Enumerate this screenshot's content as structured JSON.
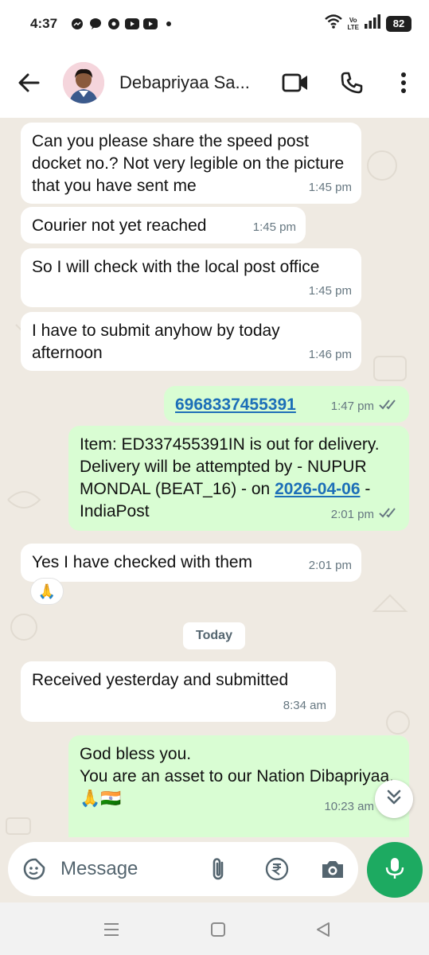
{
  "status_bar": {
    "time": "4:37",
    "battery": "82",
    "volte_top": "Vo",
    "volte_bottom": "LTE"
  },
  "header": {
    "contact_name": "Debapriyaa Sa..."
  },
  "messages": [
    {
      "text": "Can you please share the speed post docket no.? Not very legible on the picture that you have sent me",
      "time": "1:45 pm"
    },
    {
      "text": "Courier not yet reached",
      "time": "1:45 pm"
    },
    {
      "text": "So I will check with the local post office",
      "time": "1:45 pm"
    },
    {
      "text": "I have to submit anyhow by today afternoon",
      "time": "1:46 pm"
    },
    {
      "link": "6968337455391",
      "time": "1:47 pm"
    },
    {
      "text_before": "Item: ED337455391IN is out for delivery. Delivery will be attempted by - NUPUR  MONDAL (BEAT_16) - on ",
      "link": "2026-04-06",
      "text_after": " - IndiaPost",
      "time": "2:01 pm"
    },
    {
      "text": "Yes I have checked with them",
      "time": "2:01 pm",
      "reaction": "🙏"
    },
    {
      "text": "Received yesterday and submitted",
      "time": "8:34 am"
    },
    {
      "text": "God bless you.\nYou are an asset to our Nation Dibapriyaa.\n🙏🇮🇳",
      "time": "10:23 am"
    }
  ],
  "date_divider": "Today",
  "composer": {
    "placeholder": "Message"
  },
  "icons": {
    "back": "back-arrow-icon",
    "video": "video-call-icon",
    "call": "phone-icon",
    "menu": "more-vert-icon",
    "sticker": "sticker-icon",
    "attach": "paperclip-icon",
    "payment": "rupee-icon",
    "camera": "camera-icon",
    "mic": "mic-icon",
    "scroll": "double-chevron-down-icon"
  },
  "colors": {
    "incoming": "#ffffff",
    "outgoing": "#d9fdd3",
    "accent": "#1daa61",
    "link": "#1d6fb8",
    "wallpaper": "#efeae2"
  }
}
